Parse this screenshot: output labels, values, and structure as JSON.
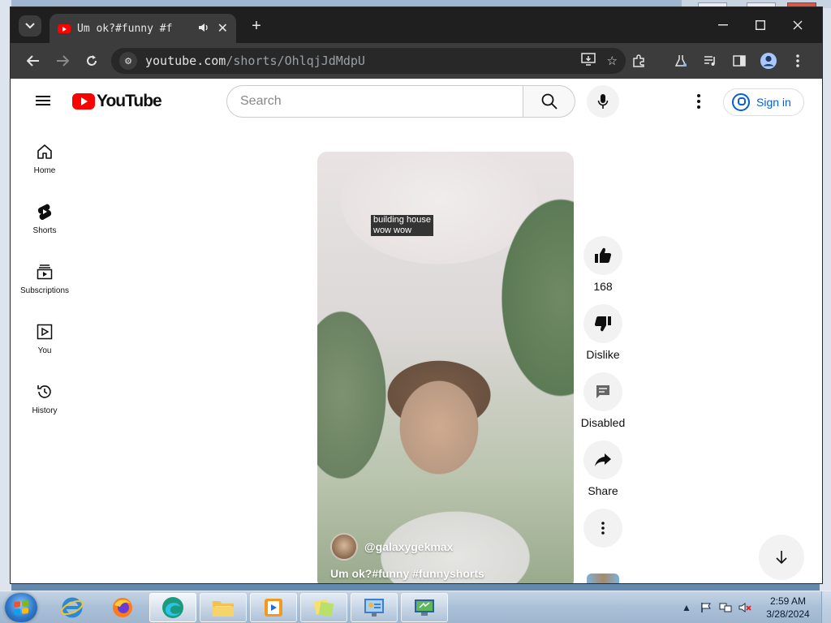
{
  "browser": {
    "tab_title": "Um ok?#funny #f",
    "url_domain": "youtube.com",
    "url_path": "/shorts/OhlqjJdMdpU"
  },
  "masthead": {
    "logo_text": "YouTube",
    "search_placeholder": "Search",
    "signin_label": "Sign in"
  },
  "guide": {
    "items": [
      {
        "label": "Home",
        "icon": "home-icon"
      },
      {
        "label": "Shorts",
        "icon": "shorts-icon"
      },
      {
        "label": "Subscriptions",
        "icon": "subscriptions-icon"
      },
      {
        "label": "You",
        "icon": "you-icon"
      },
      {
        "label": "History",
        "icon": "history-icon"
      }
    ]
  },
  "short": {
    "caption_line1": "building house",
    "caption_line2": "wow wow",
    "channel_handle": "@galaxygekmax",
    "title": "Um ok?#funny #funnyshorts"
  },
  "actions": {
    "like_count": "168",
    "dislike_label": "Dislike",
    "comments_label": "Disabled",
    "share_label": "Share"
  },
  "taskbar": {
    "time": "2:59 AM",
    "date": "3/28/2024",
    "apps": [
      "internet-explorer",
      "firefox",
      "edge",
      "file-explorer",
      "media-player",
      "sticky-notes",
      "control-panel",
      "remote-desktop"
    ]
  },
  "colors": {
    "youtube_red": "#ff0000",
    "link_blue": "#065fd4",
    "chrome_dark": "#1f1f1f",
    "chrome_toolbar": "#3c3c3c"
  }
}
